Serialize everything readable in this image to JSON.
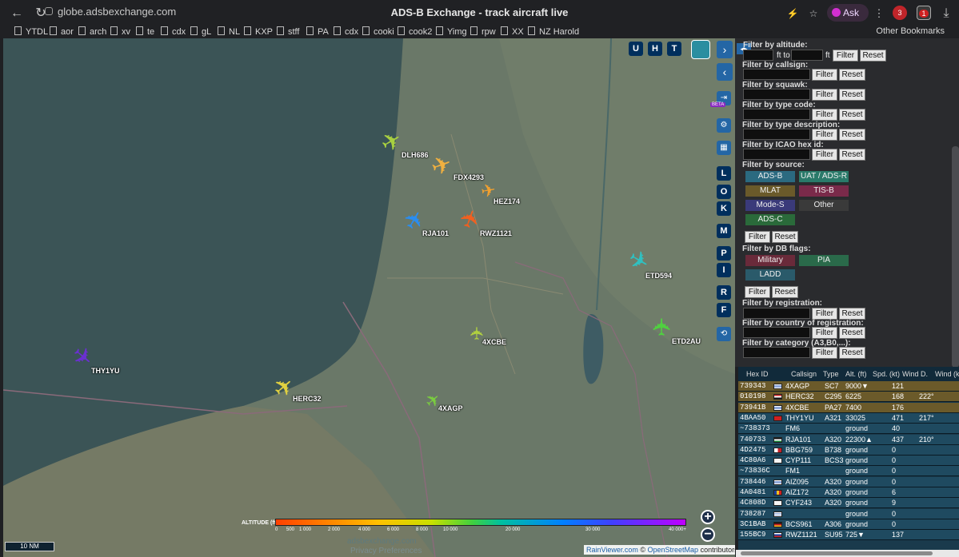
{
  "browser": {
    "url": "globe.adsbexchange.com",
    "tab_title": "ADS-B Exchange - track aircraft live",
    "ask_label": "Ask",
    "ext1_badge": "3",
    "ext2_badge": "1",
    "bookmarks": [
      "YTDL",
      "aor",
      "arch",
      "xv",
      "te",
      "cdx",
      "gL",
      "NL",
      "KXP",
      "stff",
      "PA",
      "cdx",
      "cooki",
      "cook2",
      "Yimg",
      "rpw",
      "XX",
      "NZ Harold"
    ],
    "other_bookmarks": "Other Bookmarks"
  },
  "map": {
    "aircraft": [
      {
        "callsign": "DLH686",
        "color": "#a8d040"
      },
      {
        "callsign": "FDX4293",
        "color": "#f0b040"
      },
      {
        "callsign": "HEZ174",
        "color": "#f0a030"
      },
      {
        "callsign": "RJA101",
        "color": "#2a8df0"
      },
      {
        "callsign": "RWZ1121",
        "color": "#f06020"
      },
      {
        "callsign": "ETD594",
        "color": "#30c0c0"
      },
      {
        "callsign": "ETD2AU",
        "color": "#50d040"
      },
      {
        "callsign": "4XCBE",
        "color": "#b0d040"
      },
      {
        "callsign": "THY1YU",
        "color": "#6a30d0"
      },
      {
        "callsign": "HERC32",
        "color": "#e0d040"
      },
      {
        "callsign": "4XAGP",
        "color": "#7acc40"
      }
    ],
    "top_buttons": [
      "U",
      "H",
      "T"
    ],
    "side_letters": [
      "L",
      "O",
      "K",
      "M",
      "P",
      "I",
      "R",
      "F"
    ],
    "beta_label": "BETA",
    "altitude_label": "ALTITUDE (ft)",
    "altitude_ticks": [
      "0",
      "500",
      "1 000",
      "2 000",
      "4 000",
      "6 000",
      "8 000",
      "10 000",
      "20 000",
      "30 000",
      "40 000+"
    ],
    "scale": "10 NM",
    "brand": "adsbexchange.com",
    "privacy": "Privacy Preferences",
    "attribution_1": "RainViewer.com",
    "attribution_sep": " © ",
    "attribution_2": "OpenStreetMap",
    "attribution_3": " contributors.",
    "zoom_in": "+",
    "zoom_out": "−"
  },
  "filters": {
    "altitude": "Filter by altitude:",
    "ft_to": "ft to",
    "ft": "ft",
    "callsign": "Filter by callsign:",
    "squawk": "Filter by squawk:",
    "type_code": "Filter by type code:",
    "type_desc": "Filter by type description:",
    "icao": "Filter by ICAO hex id:",
    "source": "Filter by source:",
    "db_flags": "Filter by DB flags:",
    "registration": "Filter by registration:",
    "country": "Filter by country of registration:",
    "category": "Filter by category (A3,B0,...):",
    "filter_btn": "Filter",
    "reset_btn": "Reset",
    "sources": [
      {
        "label": "ADS-B",
        "color": "#2b6a80"
      },
      {
        "label": "UAT / ADS-R",
        "color": "#2a7a6a"
      },
      {
        "label": "MLAT",
        "color": "#6a5a2a"
      },
      {
        "label": "TIS-B",
        "color": "#7a2a4a"
      },
      {
        "label": "Mode-S",
        "color": "#3a3a7a"
      },
      {
        "label": "Other",
        "color": "#3a3a3a"
      },
      {
        "label": "ADS-C",
        "color": "#2a6a3a"
      }
    ],
    "flags": [
      {
        "label": "Military",
        "color": "#6a2a3a"
      },
      {
        "label": "PIA",
        "color": "#2a6a4a"
      },
      {
        "label": "LADD",
        "color": "#2a5a6a"
      }
    ]
  },
  "table": {
    "headers": [
      "Hex ID",
      "Callsign",
      "Type",
      "Alt. (ft)",
      "Spd. (kt)",
      "Wind D.",
      "Wind (kt)"
    ],
    "rows": [
      {
        "hex": "739343",
        "flag": "il",
        "callsign": "4XAGP",
        "type": "SC7",
        "alt": "9000▼",
        "spd": "121",
        "wind": "",
        "bg": "#6b5a2a"
      },
      {
        "hex": "010198",
        "flag": "eg",
        "callsign": "HERC32",
        "type": "C295",
        "alt": "6225",
        "spd": "168",
        "wind": "222°",
        "bg": "#6b5a2a"
      },
      {
        "hex": "73941B",
        "flag": "il",
        "callsign": "4XCBE",
        "type": "PA27",
        "alt": "7400",
        "spd": "176",
        "wind": "",
        "bg": "#6b5a2a"
      },
      {
        "hex": "4BAA50",
        "flag": "tr",
        "callsign": "THY1YU",
        "type": "A321",
        "alt": "33025",
        "spd": "471",
        "wind": "217°",
        "bg": "#1f4a60"
      },
      {
        "hex": "~738373",
        "flag": "",
        "callsign": "FM6",
        "type": "",
        "alt": "ground",
        "spd": "40",
        "wind": "",
        "bg": "#1f4a60"
      },
      {
        "hex": "740733",
        "flag": "jo",
        "callsign": "RJA101",
        "type": "A320",
        "alt": "22300▲",
        "spd": "437",
        "wind": "210°",
        "bg": "#1f4a60"
      },
      {
        "hex": "4D2475",
        "flag": "mt",
        "callsign": "BBG759",
        "type": "B738",
        "alt": "ground",
        "spd": "0",
        "wind": "",
        "bg": "#1f4a60"
      },
      {
        "hex": "4C80A6",
        "flag": "cy",
        "callsign": "CYP111",
        "type": "BCS3",
        "alt": "ground",
        "spd": "0",
        "wind": "",
        "bg": "#1f4a60"
      },
      {
        "hex": "~73836C",
        "flag": "",
        "callsign": "FM1",
        "type": "",
        "alt": "ground",
        "spd": "0",
        "wind": "",
        "bg": "#1f4a60"
      },
      {
        "hex": "738446",
        "flag": "il",
        "callsign": "AIZ095",
        "type": "A320",
        "alt": "ground",
        "spd": "0",
        "wind": "",
        "bg": "#1f4a60"
      },
      {
        "hex": "4A0481",
        "flag": "ro",
        "callsign": "AIZ172",
        "type": "A320",
        "alt": "ground",
        "spd": "6",
        "wind": "",
        "bg": "#1f4a60"
      },
      {
        "hex": "4C808D",
        "flag": "cy",
        "callsign": "CYF243",
        "type": "A320",
        "alt": "ground",
        "spd": "9",
        "wind": "",
        "bg": "#1f4a60"
      },
      {
        "hex": "738287",
        "flag": "il",
        "callsign": "",
        "type": "",
        "alt": "ground",
        "spd": "0",
        "wind": "",
        "bg": "#1f4a60"
      },
      {
        "hex": "3C1BAB",
        "flag": "de",
        "callsign": "BCS961",
        "type": "A306",
        "alt": "ground",
        "spd": "0",
        "wind": "",
        "bg": "#1f4a60"
      },
      {
        "hex": "155BC9",
        "flag": "ru",
        "callsign": "RWZ1121",
        "type": "SU95",
        "alt": "725▼",
        "spd": "137",
        "wind": "",
        "bg": "#1f4a60"
      }
    ]
  }
}
